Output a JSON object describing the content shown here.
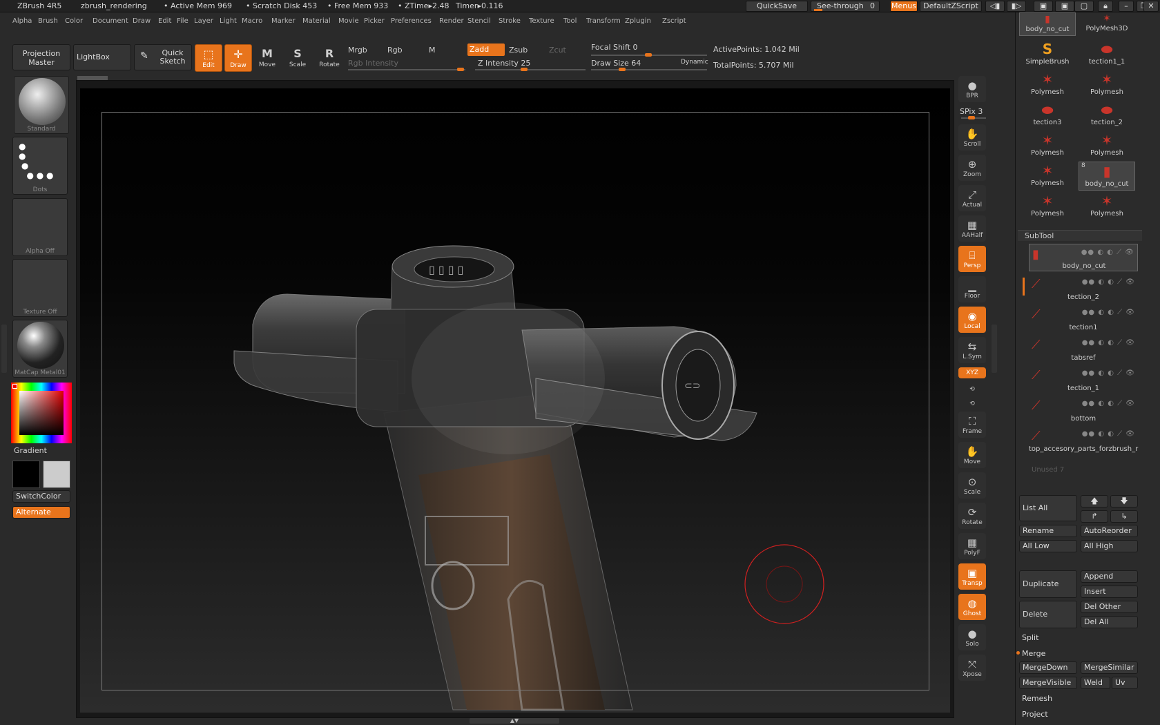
{
  "titlebar": {
    "app": "ZBrush 4R5",
    "document": "zbrush_rendering",
    "active_mem": "• Active Mem 969",
    "scratch_disk": "• Scratch Disk 453",
    "free_mem": "• Free Mem 933",
    "ztime": "• ZTime▸2.48",
    "timer": "Timer▸0.116",
    "quicksave": "QuickSave",
    "see_through": "See-through",
    "see_through_value": "0",
    "menus": "Menus",
    "default_zscript": "DefaultZScript"
  },
  "menubar": {
    "items": [
      "Alpha",
      "Brush",
      "Color",
      "Document",
      "Draw",
      "Edit",
      "File",
      "Layer",
      "Light",
      "Macro",
      "Marker",
      "Material",
      "Movie",
      "Picker",
      "Preferences",
      "Render",
      "Stencil",
      "Stroke",
      "Texture",
      "Tool",
      "Transform",
      "Zplugin",
      "Zscript"
    ]
  },
  "toolbar": {
    "projection_master": "Projection Master",
    "lightbox": "LightBox",
    "quick_sketch": "Quick Sketch",
    "edit": "Edit",
    "draw": "Draw",
    "move": "Move",
    "scale": "Scale",
    "rotate": "Rotate",
    "mrgb": "Mrgb",
    "rgb": "Rgb",
    "m": "M",
    "zadd": "Zadd",
    "zsub": "Zsub",
    "zcut": "Zcut",
    "rgb_intensity": "Rgb Intensity",
    "z_intensity": "Z Intensity 25",
    "focal_shift": "Focal Shift 0",
    "draw_size": "Draw Size 64",
    "dynamic": "Dynamic",
    "active_points": "ActivePoints: 1.042 Mil",
    "total_points": "TotalPoints: 5.707 Mil"
  },
  "lefttray": {
    "brush": "Standard",
    "stroke": "Dots",
    "alpha": "Alpha Off",
    "texture": "Texture Off",
    "material": "MatCap Metal01",
    "gradient": "Gradient",
    "switchcolor": "SwitchColor",
    "alternate": "Alternate"
  },
  "rightshelf": {
    "bpr": "BPR",
    "spix": "SPix 3",
    "scroll": "Scroll",
    "zoom": "Zoom",
    "actual": "Actual",
    "aahalf": "AAHalf",
    "persp": "Persp",
    "floor": "Floor",
    "local": "Local",
    "lsym": "L.Sym",
    "xyz": "XYZ",
    "frame": "Frame",
    "move": "Move",
    "scale": "Scale",
    "rotate": "Rotate",
    "polyf": "PolyF",
    "transp": "Transp",
    "ghost": "Ghost",
    "solo": "Solo",
    "xpose": "Xpose"
  },
  "toolpalette": {
    "items": [
      {
        "label": "body_no_cut",
        "icon": "mesh-icon"
      },
      {
        "label": "PolyMesh3D",
        "icon": "star-icon"
      },
      {
        "label": "SimpleBrush",
        "icon": "s-brush-icon"
      },
      {
        "label": "tection1_1",
        "icon": "cylinder-icon"
      },
      {
        "label": "Polymesh",
        "icon": "star-icon"
      },
      {
        "label": "Polymesh",
        "icon": "star-icon"
      },
      {
        "label": "tection3",
        "icon": "cylinder-icon"
      },
      {
        "label": "tection_2",
        "icon": "cylinder-icon"
      },
      {
        "label": "Polymesh",
        "icon": "star-icon"
      },
      {
        "label": "Polymesh",
        "icon": "star-icon"
      },
      {
        "label": "Polymesh",
        "icon": "star-icon"
      },
      {
        "label": "body_no_cut",
        "icon": "mesh-icon",
        "badge": "8"
      },
      {
        "label": "Polymesh",
        "icon": "star-icon"
      },
      {
        "label": "Polymesh",
        "icon": "star-icon"
      }
    ]
  },
  "subtool": {
    "title": "SubTool",
    "items": [
      "body_no_cut",
      "tection_2",
      "tection1",
      "tabsref",
      "tection_1",
      "bottom",
      "top_accesory_parts_forzbrush_r"
    ],
    "unused": "Unused 7",
    "list_all": "List All",
    "rename": "Rename",
    "autoreorder": "AutoReorder",
    "all_low": "All Low",
    "all_high": "All High",
    "duplicate": "Duplicate",
    "append": "Append",
    "insert": "Insert",
    "delete": "Delete",
    "del_other": "Del Other",
    "del_all": "Del All",
    "split": "Split",
    "merge": "Merge",
    "mergedown": "MergeDown",
    "mergesimilar": "MergeSimilar",
    "mergevisible": "MergeVisible",
    "weld": "Weld",
    "uv": "Uv",
    "remesh": "Remesh",
    "project": "Project"
  },
  "colors": {
    "accent": "#e8741c",
    "panel": "#2b2b2b",
    "tool_red": "#c9352b"
  }
}
